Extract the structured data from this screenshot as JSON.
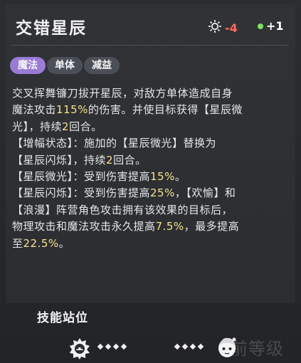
{
  "skill": {
    "name": "交错星辰",
    "cost_value": "-4",
    "gain_value": "+1",
    "tags": [
      "魔法",
      "单体",
      "减益"
    ]
  },
  "description": {
    "line1a": "交叉挥舞镰刀拔开星辰，对敌方单体造成自身",
    "line2a": "魔法攻击",
    "line2_pct": "115%",
    "line2b": "的伤害。并使目标获得【星辰微",
    "line3a": "光】，持续",
    "line3_num": "2",
    "line3b": "回合。",
    "line4": "【增幅状态】：施加的【星辰微光】替换为",
    "line5a": "【星辰闪烁】，持续",
    "line5_num": "2",
    "line5b": "回合。",
    "line6a": "【星辰微光】：受到伤害提高",
    "line6_pct": "15%",
    "line6b": "。",
    "line7a": "【星辰闪烁】：受到伤害提高",
    "line7_pct": "25%",
    "line7b": "，【欢愉】和",
    "line8": "【浪漫】阵营角色攻击拥有该效果的目标后，",
    "line9a": "物理攻击和魔法攻击永久提高",
    "line9_pct": "7.5%",
    "line9b": "，最多提高",
    "line10a": "至",
    "line10_pct": "22.5%",
    "line10b": "。"
  },
  "stance": {
    "title": "技能站位"
  },
  "watermark": "前等级",
  "colors": {
    "cost": "#ff6a5c",
    "gain_dot": "#7ee05b",
    "magic_tag": "#9a7cd6",
    "other_tag": "#4b5058",
    "highlight": "#f6e28a"
  }
}
